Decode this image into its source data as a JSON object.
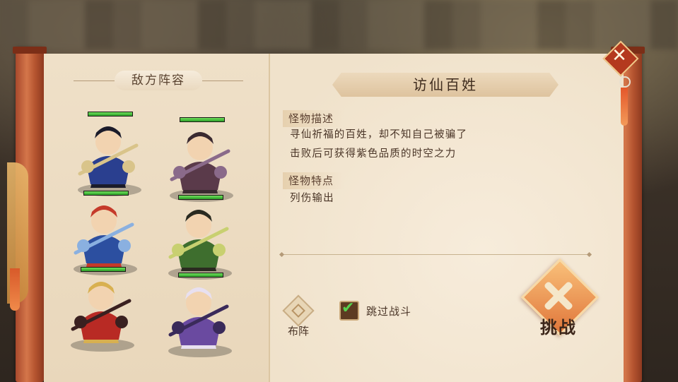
{
  "enemy_lineup": {
    "title": "敌方阵容",
    "units": [
      {
        "name": "blue-armored-general",
        "hp": 1.0,
        "colors": [
          "#2a3f8f",
          "#1b1b2a",
          "#d9c48a"
        ]
      },
      {
        "name": "dark-brute-warrior",
        "hp": 1.0,
        "colors": [
          "#5a3a4a",
          "#3a2a30",
          "#8a6a8a"
        ]
      },
      {
        "name": "red-haired-blade-warrior",
        "hp": 1.0,
        "colors": [
          "#2c4fa0",
          "#c53a2a",
          "#8ab0e0"
        ]
      },
      {
        "name": "green-armored-spearman",
        "hp": 1.0,
        "colors": [
          "#3e6e2e",
          "#2a2a20",
          "#c8d070"
        ]
      },
      {
        "name": "golden-helmet-archer",
        "hp": 1.0,
        "colors": [
          "#b82a24",
          "#d8b050",
          "#3a2020"
        ]
      },
      {
        "name": "purple-fan-lady",
        "hp": 1.0,
        "colors": [
          "#6a4aa0",
          "#e8e0f0",
          "#3a2a5a"
        ]
      }
    ]
  },
  "monster": {
    "name": "访仙百姓",
    "description_tag": "怪物描述",
    "description_lines": [
      "寻仙祈福的百姓，却不知自己被骗了",
      "击败后可获得紫色品质的时空之力"
    ],
    "traits_tag": "怪物特点",
    "traits_text": "列伤输出"
  },
  "actions": {
    "formation_label": "布阵",
    "skip_battle_label": "跳过战斗",
    "skip_battle_checked": true,
    "challenge_label": "挑战",
    "close_symbol": "✕"
  },
  "colors": {
    "paper": "#f3e6d1",
    "rod": "#c0613a",
    "hp_bar": "#3cb83a",
    "challenge_orange": "#e8843f"
  }
}
